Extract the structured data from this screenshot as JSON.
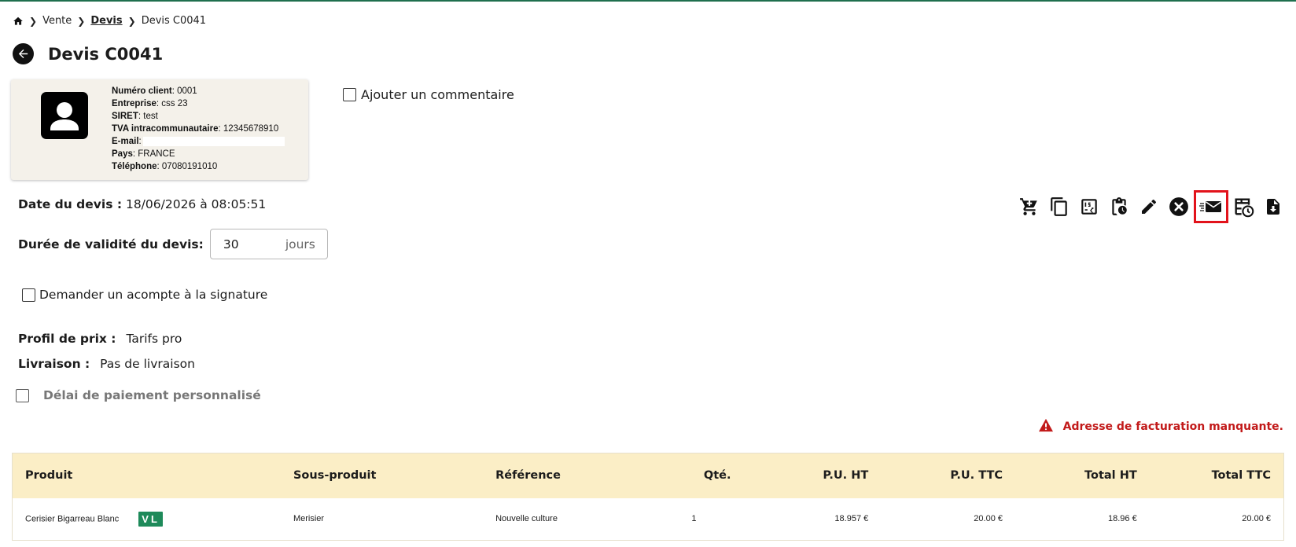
{
  "breadcrumb": {
    "items": [
      "Vente",
      "Devis",
      "Devis C0041"
    ]
  },
  "page": {
    "title": "Devis C0041"
  },
  "client": {
    "numero_label": "Numéro client",
    "numero_value": ": 0001",
    "entreprise_label": "Entreprise",
    "entreprise_value": ": css 23",
    "siret_label": "SIRET",
    "siret_value": ": test",
    "tva_label": "TVA intracommunautaire",
    "tva_value": ": 12345678910",
    "email_label": "E-mail",
    "email_value": ":",
    "pays_label": "Pays",
    "pays_value": ": FRANCE",
    "telephone_label": "Téléphone",
    "telephone_value": ": 07080191010"
  },
  "comment": {
    "label": "Ajouter un commentaire"
  },
  "devis": {
    "date_label": "Date du devis :",
    "date_value": "18/06/2026 à 08:05:51",
    "validity_label": "Durée de validité du devis:",
    "validity_value": "30",
    "validity_unit": "jours",
    "acompte_label": "Demander un acompte à la signature",
    "profil_label": "Profil de prix :",
    "profil_value": "Tarifs pro",
    "livraison_label": "Livraison :",
    "livraison_value": "Pas de livraison",
    "delai_label": "Délai de paiement personnalisé"
  },
  "toolbar": {
    "icons": [
      "cart-icon",
      "copy-icon",
      "calculator-icon",
      "clipboard-clock-icon",
      "edit-icon",
      "cancel-icon",
      "send-email-icon",
      "table-clock-icon",
      "download-document-icon"
    ]
  },
  "warning": {
    "text": "Adresse de facturation manquante."
  },
  "table": {
    "headers": [
      "Produit",
      "Sous-produit",
      "Référence",
      "Qté.",
      "P.U. HT",
      "P.U. TTC",
      "Total HT",
      "Total TTC"
    ],
    "rows": [
      {
        "produit": "Cerisier Bigarreau Blanc",
        "badge": "VL",
        "sous_produit": "Merisier",
        "reference": "Nouvelle culture",
        "qte": "1",
        "pu_ht": "18.957 €",
        "pu_ttc": "20.00 €",
        "total_ht": "18.96 €",
        "total_ttc": "20.00 €"
      }
    ]
  },
  "colors": {
    "accent_green": "#1e8a5a",
    "table_header": "#fbeec6",
    "card_bg": "#f4f1ea",
    "warning_red": "#c21a1a",
    "highlight_red": "#e2131b"
  }
}
